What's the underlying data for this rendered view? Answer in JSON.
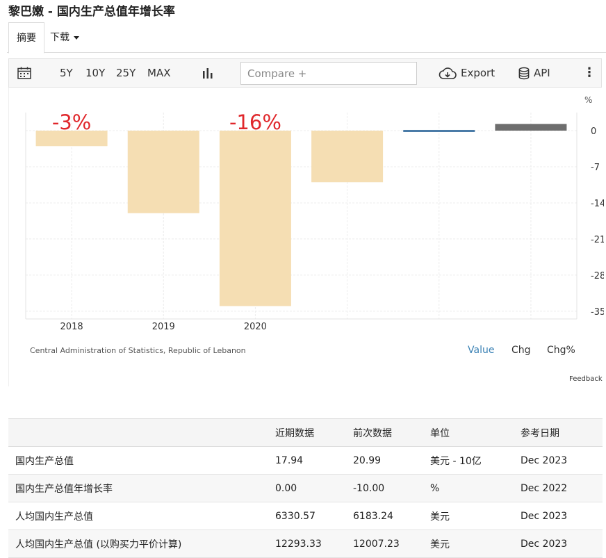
{
  "page": {
    "title": "黎巴嫩 - 国内生产总值年增长率"
  },
  "tabs": {
    "summary": "摘要",
    "download": "下载"
  },
  "toolbar": {
    "ranges": [
      "5Y",
      "10Y",
      "25Y",
      "MAX"
    ],
    "compare_placeholder": "Compare +",
    "export_label": "Export",
    "api_label": "API",
    "more_label": "⋮"
  },
  "chart": {
    "source": "Central Administration of Statistics, Republic of Lebanon",
    "views": {
      "value": "Value",
      "chg": "Chg",
      "chg_pct": "Chg%"
    },
    "feedback": "Feedback"
  },
  "chart_data": {
    "type": "bar",
    "x_tick_labels": [
      "2018",
      "2019",
      "2020"
    ],
    "y_unit_label": "%",
    "y_ticks": [
      0,
      -7,
      -14,
      -21,
      -28,
      -35
    ],
    "ylim": [
      -36.5,
      3.5
    ],
    "bars": [
      {
        "x": "2018",
        "value": -3
      },
      {
        "x": "2019",
        "value": -16
      },
      {
        "x": "2020",
        "value": -34
      },
      {
        "x": "2021",
        "value": -10
      },
      {
        "x": "2022",
        "value": 0
      },
      {
        "x": "2023",
        "value": 1.3
      }
    ],
    "annotations": [
      {
        "x": "2018",
        "text": "-3%"
      },
      {
        "x": "2020",
        "text": "-16%"
      }
    ],
    "grid": true,
    "colors": {
      "bar": "#f5deb3",
      "zero_line": "#4a7ba7",
      "last_bar": "#6e6e6e",
      "annotation": "#e0272b"
    }
  },
  "table": {
    "headers": [
      "",
      "近期数据",
      "前次数据",
      "单位",
      "参考日期"
    ],
    "rows": [
      [
        "国内生产总值",
        "17.94",
        "20.99",
        "美元 - 10亿",
        "Dec 2023"
      ],
      [
        "国内生产总值年增长率",
        "0.00",
        "-10.00",
        "%",
        "Dec 2022"
      ],
      [
        "人均国内生产总值",
        "6330.57",
        "6183.24",
        "美元",
        "Dec 2023"
      ],
      [
        "人均国内生产总值 (以购买力平价计算)",
        "12293.33",
        "12007.23",
        "美元",
        "Dec 2023"
      ]
    ]
  }
}
